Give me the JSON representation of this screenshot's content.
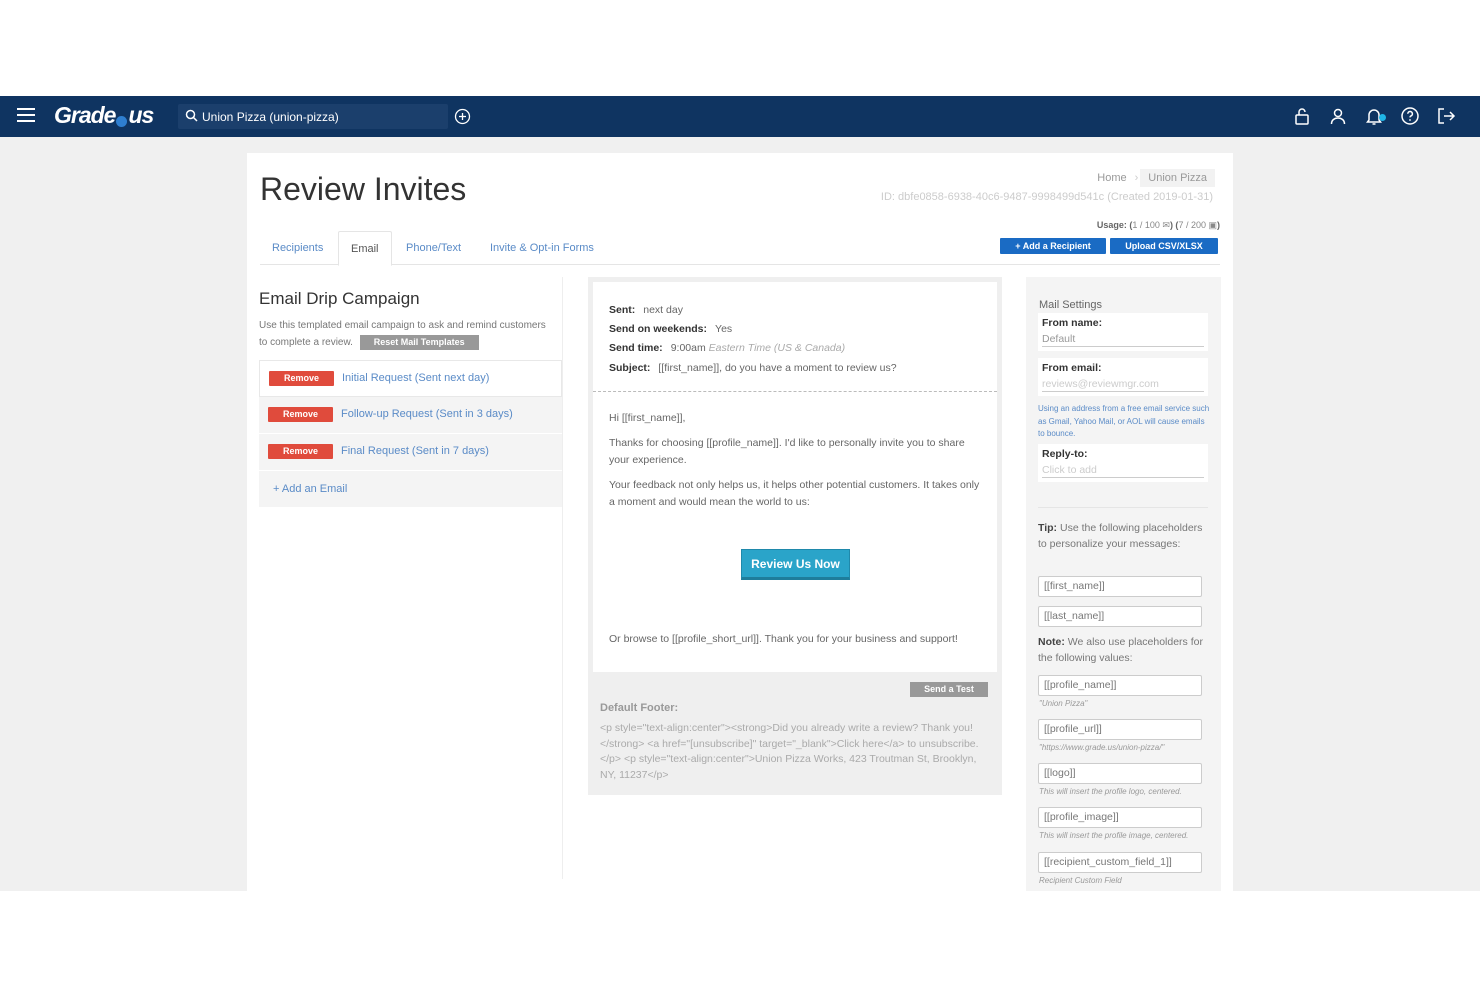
{
  "app": {
    "logo_text": "Grade",
    "logo_text2": "us"
  },
  "header": {
    "search_value": "Union Pizza (union-pizza)"
  },
  "breadcrumb": {
    "home": "Home",
    "current": "Union Pizza"
  },
  "page": {
    "title": "Review Invites",
    "id_line": "ID: dbfe0858-6938-40c6-9487-9998499d541c (Created 2019-01-31)",
    "usage_prefix": "Usage: (",
    "usage_a": "1 / 100",
    "usage_mid": ") (",
    "usage_b": "7 / 200",
    "usage_suffix": ")"
  },
  "actions": {
    "add_recipient": "+ Add a Recipient",
    "upload": "Upload CSV/XLSX"
  },
  "tabs": [
    {
      "label": "Recipients"
    },
    {
      "label": "Email"
    },
    {
      "label": "Phone/Text"
    },
    {
      "label": "Invite & Opt-in Forms"
    }
  ],
  "campaign": {
    "title": "Email Drip Campaign",
    "description": "Use this templated email campaign to ask and remind customers to complete a review.",
    "reset_label": "Reset Mail Templates",
    "remove_label": "Remove",
    "emails": [
      {
        "label": "Initial Request (Sent next day)"
      },
      {
        "label": "Follow-up Request (Sent in 3 days)"
      },
      {
        "label": "Final Request (Sent in 7 days)"
      }
    ],
    "add_email": "+ Add an Email"
  },
  "email": {
    "sent_label": "Sent:",
    "sent_value": "next day",
    "weekends_label": "Send on weekends:",
    "weekends_value": "Yes",
    "time_label": "Send time:",
    "time_value": "9:00am",
    "time_zone": "Eastern Time (US & Canada)",
    "subject_label": "Subject:",
    "subject_value": "[[first_name]], do you have a moment to review us?",
    "greeting": "Hi [[first_name]],",
    "para1": "Thanks for choosing [[profile_name]]. I'd like to personally invite you to share your experience.",
    "para2": "Your feedback not only helps us, it helps other potential customers. It takes only a moment and would mean the world to us:",
    "cta": "Review Us Now",
    "closing": "Or browse to [[profile_short_url]]. Thank you for your business and support!",
    "send_test": "Send a Test",
    "footer_label": "Default Footer:",
    "footer_code": "<p style=\"text-align:center\"><strong>Did you already write a review? Thank you!</strong> <a href=\"[unsubscribe]\" target=\"_blank\">Click here</a> to unsubscribe.</p> <p style=\"text-align:center\">Union Pizza Works, 423 Troutman St, Brooklyn, NY, 11237</p>"
  },
  "mail_settings": {
    "title": "Mail Settings",
    "from_name_label": "From name:",
    "from_name_value": "Default",
    "from_email_label": "From email:",
    "from_email_value": "reviews@reviewmgr.com",
    "from_email_note": "Using an address from a free email service such as Gmail, Yahoo Mail, or AOL will cause emails to bounce.",
    "reply_to_label": "Reply-to:",
    "reply_to_value": "Click to add"
  },
  "tips": {
    "tip_label": "Tip:",
    "tip_text": "Use the following placeholders to personalize your messages:",
    "ph_first": "[[first_name]]",
    "ph_last": "[[last_name]]",
    "note_label": "Note:",
    "note_text": "We also use placeholders for the following values:",
    "values": [
      {
        "ph": "[[profile_name]]",
        "hint": "\"Union Pizza\""
      },
      {
        "ph": "[[profile_url]]",
        "hint": "\"https://www.grade.us/union-pizza/\""
      },
      {
        "ph": "[[logo]]",
        "hint": "This will insert the profile logo, centered."
      },
      {
        "ph": "[[profile_image]]",
        "hint": "This will insert the profile image, centered."
      },
      {
        "ph": "[[recipient_custom_field_1]]",
        "hint": "Recipient Custom Field"
      }
    ]
  },
  "colors": {
    "nav_bg": "#0f3461",
    "primary": "#1a6bc4",
    "danger": "#e04b3c",
    "cta": "#2aa4c9"
  }
}
